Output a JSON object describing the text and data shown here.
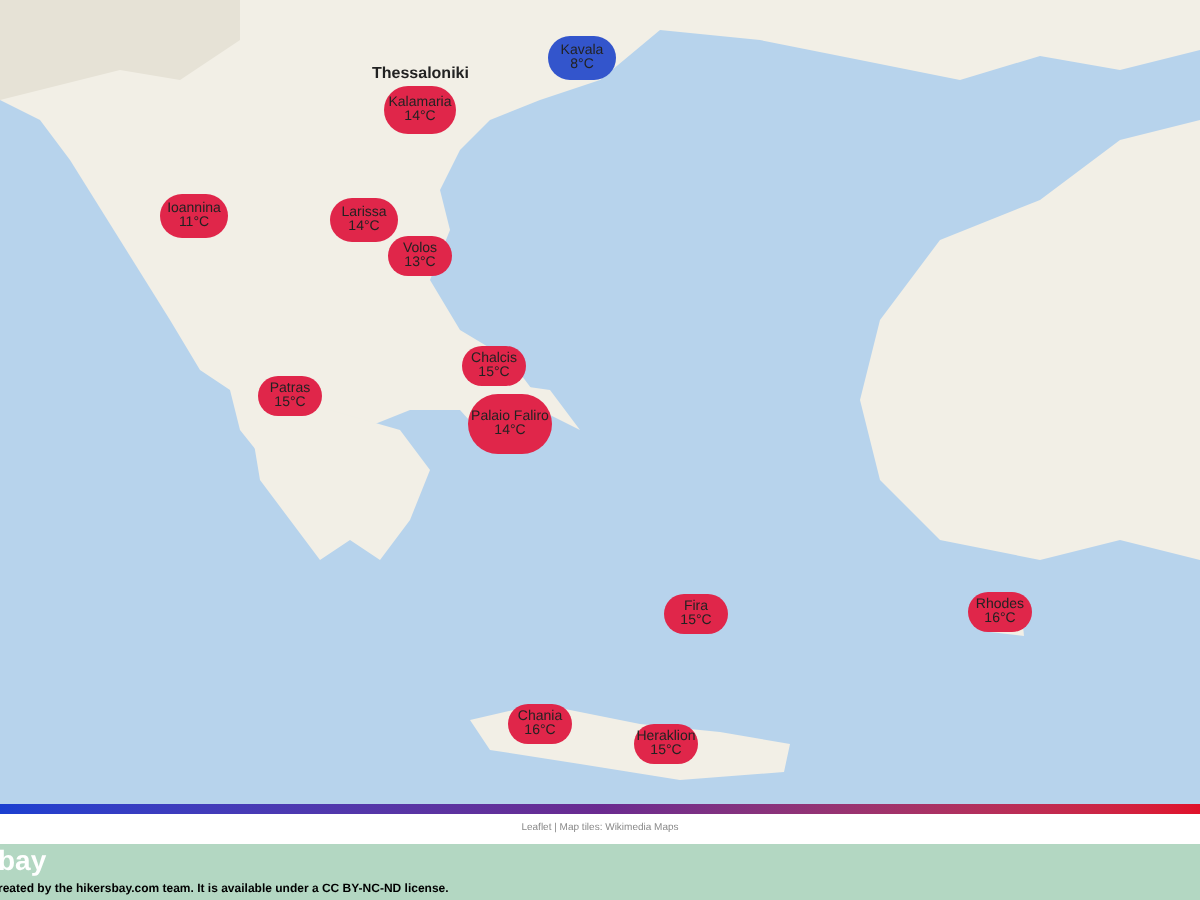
{
  "map": {
    "markers": [
      {
        "name": "Kavala",
        "temp": "8°C",
        "color": "#3355cc"
      },
      {
        "name": "Kalamaria",
        "temp": "14°C",
        "color": "#e0264a"
      },
      {
        "name": "Ioannina",
        "temp": "11°C",
        "color": "#e0264a"
      },
      {
        "name": "Larissa",
        "temp": "14°C",
        "color": "#e0264a"
      },
      {
        "name": "Volos",
        "temp": "13°C",
        "color": "#e0264a"
      },
      {
        "name": "Chalcis",
        "temp": "15°C",
        "color": "#e0264a"
      },
      {
        "name": "Patras",
        "temp": "15°C",
        "color": "#e0264a"
      },
      {
        "name": "Palaio Faliro",
        "temp": "14°C",
        "color": "#e0264a"
      },
      {
        "name": "Fira",
        "temp": "15°C",
        "color": "#e0264a"
      },
      {
        "name": "Rhodes",
        "temp": "16°C",
        "color": "#e0264a"
      },
      {
        "name": "Chania",
        "temp": "16°C",
        "color": "#e0264a"
      },
      {
        "name": "Heraklion",
        "temp": "15°C",
        "color": "#e0264a"
      }
    ],
    "city_label": "Thessaloniki",
    "attribution": "Leaflet | Map tiles: Wikimedia Maps"
  },
  "footer": {
    "title": "bay",
    "notice": "reated by the hikersbay.com team. It is available under a CC BY-NC-ND license."
  }
}
